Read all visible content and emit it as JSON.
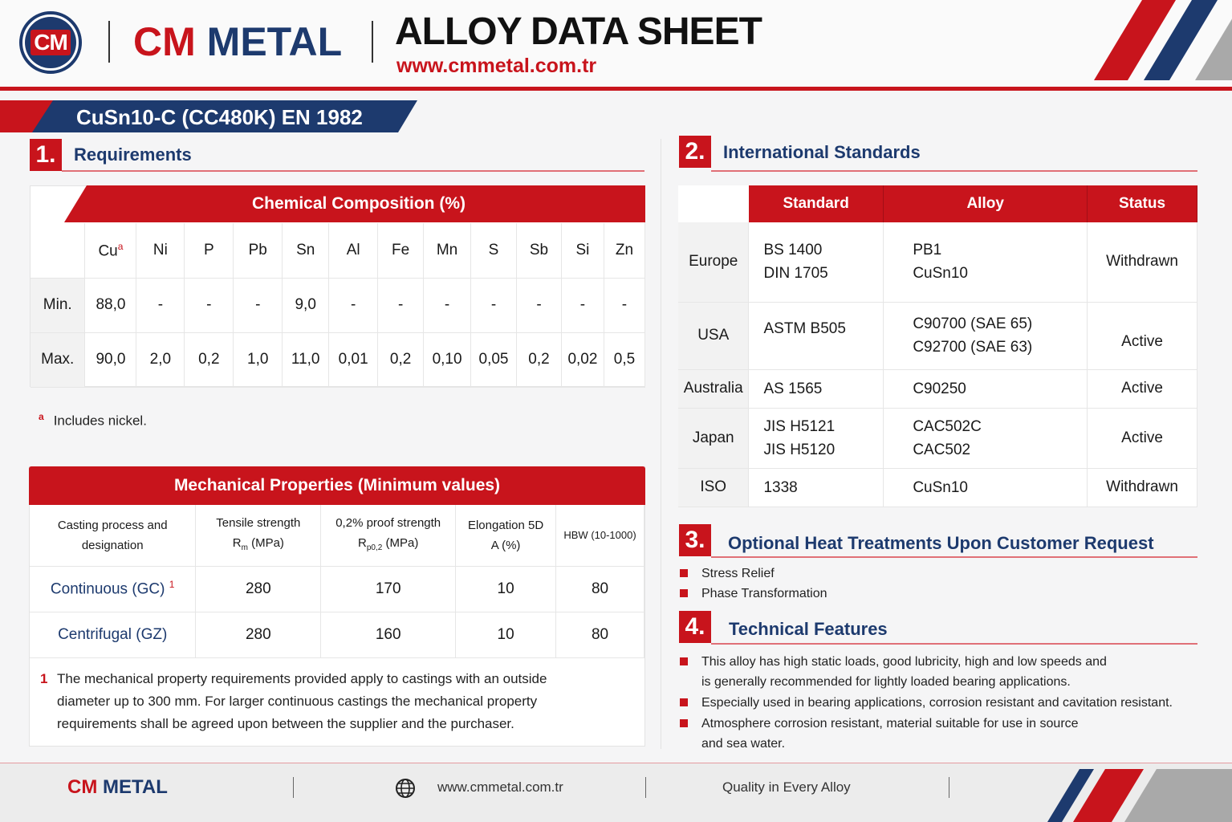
{
  "header": {
    "logo_text": "CM",
    "brand_cm": "CM",
    "brand_metal": "METAL",
    "title": "ALLOY DATA SHEET",
    "url": "www.cmmetal.com.tr"
  },
  "alloy": {
    "designation": "CuSn10-C (CC480K) EN 1982"
  },
  "section1": {
    "number": "1.",
    "title": "Requirements",
    "chemical": {
      "title": "Chemical Composition (%)",
      "elements": [
        "Cu",
        "Ni",
        "P",
        "Pb",
        "Sn",
        "Al",
        "Fe",
        "Mn",
        "S",
        "Sb",
        "Si",
        "Zn"
      ],
      "cu_marker": "a",
      "rows": [
        {
          "label": "Min.",
          "values": [
            "88,0",
            "-",
            "-",
            "-",
            "9,0",
            "-",
            "-",
            "-",
            "-",
            "-",
            "-",
            "-"
          ]
        },
        {
          "label": "Max.",
          "values": [
            "90,0",
            "2,0",
            "0,2",
            "1,0",
            "11,0",
            "0,01",
            "0,2",
            "0,10",
            "0,05",
            "0,2",
            "0,02",
            "0,5"
          ]
        }
      ],
      "footnote_marker": "a",
      "footnote": "Includes nickel."
    },
    "mechanical": {
      "title": "Mechanical Properties (Minimum values)",
      "headers": [
        {
          "line1": "Casting process and",
          "line2": "designation"
        },
        {
          "line1": "Tensile strength",
          "line2": "R",
          "sub": "m",
          "unit": " (MPa)"
        },
        {
          "line1": "0,2% proof strength",
          "line2": "R",
          "sub": "p0,2",
          "unit": " (MPa)"
        },
        {
          "line1": "Elongation 5D",
          "line2": "A (%)"
        },
        {
          "line1": "HBW (10-1000)"
        }
      ],
      "rows": [
        {
          "process": "Continuous (GC)",
          "marker": "1",
          "values": [
            "280",
            "170",
            "10",
            "80"
          ]
        },
        {
          "process": "Centrifugal (GZ)",
          "marker": "",
          "values": [
            "280",
            "160",
            "10",
            "80"
          ]
        }
      ],
      "note_marker": "1",
      "note": "The mechanical property requirements provided apply to castings with an outside diameter up to 300 mm. For larger continuous castings the mechanical property requirements shall be agreed upon between the supplier and the purchaser."
    }
  },
  "section2": {
    "number": "2.",
    "title": "International Standards",
    "headers": [
      "Standard",
      "Alloy",
      "Status"
    ],
    "rows": [
      {
        "region": "Europe",
        "standards": [
          "BS 1400",
          "DIN 1705"
        ],
        "alloys": [
          "PB1",
          "CuSn10"
        ],
        "status": "Withdrawn"
      },
      {
        "region": "USA",
        "standards": [
          "ASTM B505"
        ],
        "alloys": [
          "C90700 (SAE 65)",
          "C92700 (SAE 63)"
        ],
        "status": "Active"
      },
      {
        "region": "Australia",
        "standards": [
          "AS 1565"
        ],
        "alloys": [
          "C90250"
        ],
        "status": "Active"
      },
      {
        "region": "Japan",
        "standards": [
          "JIS H5121",
          "JIS H5120"
        ],
        "alloys": [
          "CAC502C",
          "CAC502"
        ],
        "status": "Active"
      },
      {
        "region": "ISO",
        "standards": [
          "1338"
        ],
        "alloys": [
          "CuSn10"
        ],
        "status": "Withdrawn"
      }
    ]
  },
  "section3": {
    "number": "3.",
    "title": "Optional Heat Treatments Upon Customer Request",
    "items": [
      "Stress Relief",
      "Phase Transformation"
    ]
  },
  "section4": {
    "number": "4.",
    "title": "Technical Features",
    "items": [
      {
        "line1": "This alloy has high static loads, good lubricity, high and low speeds and",
        "line2": "is generally recommended for lightly loaded bearing applications."
      },
      {
        "line1": "Especially used in bearing applications, corrosion resistant and cavitation resistant.",
        "line2": ""
      },
      {
        "line1": "Atmosphere corrosion resistant, material suitable for use in source",
        "line2": "and sea water."
      }
    ]
  },
  "footer": {
    "brand_cm": "CM",
    "brand_metal": "METAL",
    "url": "www.cmmetal.com.tr",
    "tagline": "Quality in Every Alloy",
    "globe_icon": "globe-icon"
  },
  "colors": {
    "red": "#c8141c",
    "navy": "#1d3a6e",
    "gray": "#a9a9a9"
  }
}
